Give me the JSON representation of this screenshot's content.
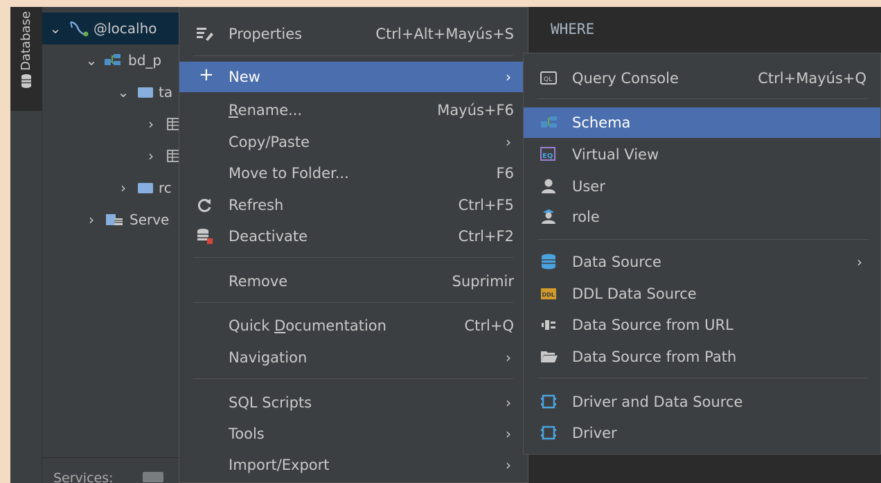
{
  "sidebar": {
    "tab_label": "Database"
  },
  "tree": {
    "rows": [
      {
        "label": "@localho",
        "expanded": true
      },
      {
        "label": "bd_p",
        "expanded": true
      },
      {
        "label": "ta",
        "expanded": true
      },
      {
        "label": "",
        "expanded": false
      },
      {
        "label": "",
        "expanded": false
      },
      {
        "label": "rc",
        "expanded": false
      },
      {
        "label": "Serve",
        "expanded": false
      }
    ]
  },
  "services": {
    "label": "Services:"
  },
  "editor": {
    "keyword": "WHERE"
  },
  "context_menu": {
    "items": [
      {
        "label": "Properties",
        "shortcut": "Ctrl+Alt+Mayús+S"
      },
      {
        "label": "New",
        "submenu": "›"
      },
      {
        "label_prefix": "",
        "label_mnemonic": "R",
        "label_rest": "ename...",
        "shortcut": "Mayús+F6"
      },
      {
        "label": "Copy/Paste",
        "submenu": "›"
      },
      {
        "label": "Move to Folder...",
        "shortcut": "F6"
      },
      {
        "label": "Refresh",
        "shortcut": "Ctrl+F5"
      },
      {
        "label": "Deactivate",
        "shortcut": "Ctrl+F2"
      },
      {
        "label": "Remove",
        "shortcut": "Suprimir"
      },
      {
        "label_prefix": "Quick ",
        "label_mnemonic": "D",
        "label_rest": "ocumentation",
        "shortcut": "Ctrl+Q"
      },
      {
        "label": "Navigation",
        "submenu": "›"
      },
      {
        "label": "SQL Scripts",
        "submenu": "›"
      },
      {
        "label": "Tools",
        "submenu": "›"
      },
      {
        "label": "Import/Export",
        "submenu": "›"
      }
    ]
  },
  "new_submenu": {
    "items": [
      {
        "label": "Query Console",
        "shortcut": "Ctrl+Mayús+Q"
      },
      {
        "label": "Schema"
      },
      {
        "label": "Virtual View"
      },
      {
        "label": "User"
      },
      {
        "label": "role"
      },
      {
        "label": "Data Source",
        "submenu": "›"
      },
      {
        "label": "DDL Data Source"
      },
      {
        "label": "Data Source from URL"
      },
      {
        "label": "Data Source from Path"
      },
      {
        "label": "Driver and Data Source"
      },
      {
        "label": "Driver"
      }
    ]
  },
  "colors": {
    "highlight": "#4b6eaf",
    "menu_bg": "#3c3f41",
    "text": "#c9c9c9",
    "page_border": "#f4dcc4"
  }
}
